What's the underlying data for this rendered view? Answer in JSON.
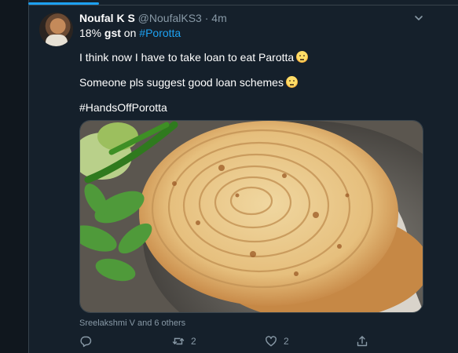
{
  "tweet": {
    "author_name": "Noufal K S",
    "author_handle": "@NoufalKS3",
    "separator": "·",
    "time": "4m",
    "line1_prefix": "18% ",
    "line1_bold": "gst",
    "line1_mid": " on ",
    "line1_hashtag": "#Porotta",
    "text1": "I think now I have to take loan to eat Parotta",
    "text2": "Someone pls suggest good loan schemes",
    "hashtag_line": "#HandsOffPorotta",
    "liked_by": "Sreelakshmi V and 6 others",
    "retweet_count": "2",
    "like_count": "2"
  },
  "icons": {
    "menu": "chevron-down-icon",
    "reply": "reply-icon",
    "retweet": "retweet-icon",
    "like": "heart-icon",
    "share": "share-icon"
  },
  "colors": {
    "background": "#15202b",
    "outer": "#10171e",
    "accent": "#1da1f2",
    "secondary_text": "#8899a6",
    "border": "#38444d"
  }
}
